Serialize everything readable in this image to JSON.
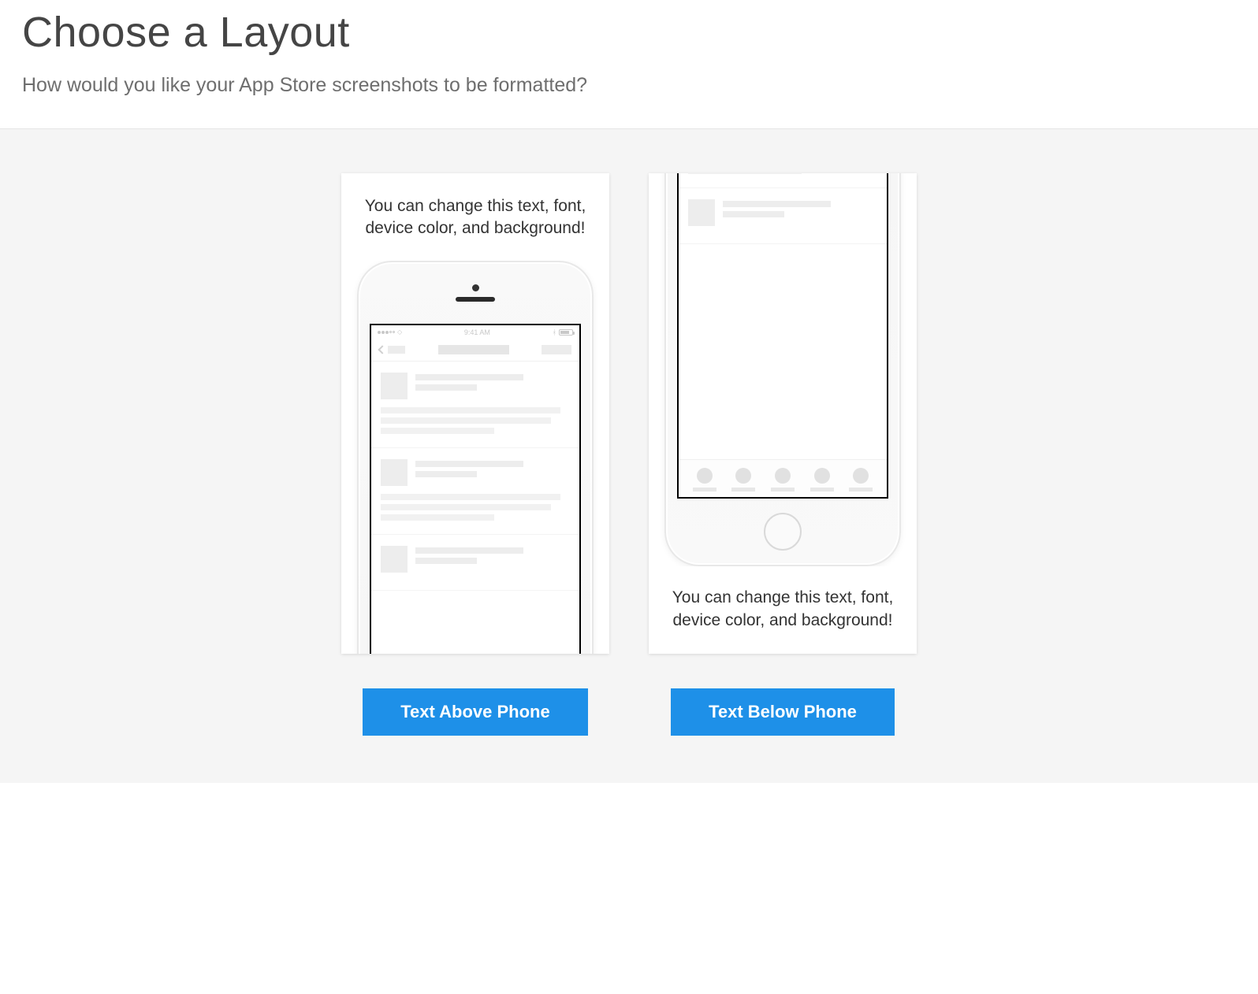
{
  "header": {
    "title": "Choose a Layout",
    "subtitle": "How would you like your App Store screenshots to be formatted?"
  },
  "options": {
    "text_above": {
      "preview_text": "You can change this text, font, device color, and background!",
      "button_label": "Text Above Phone",
      "status_time": "9:41 AM"
    },
    "text_below": {
      "preview_text": "You can change this text, font, device color, and background!",
      "button_label": "Text Below Phone"
    }
  },
  "colors": {
    "primary": "#1e90e8",
    "page_bg": "#f5f5f5",
    "card_bg": "#ffffff"
  }
}
